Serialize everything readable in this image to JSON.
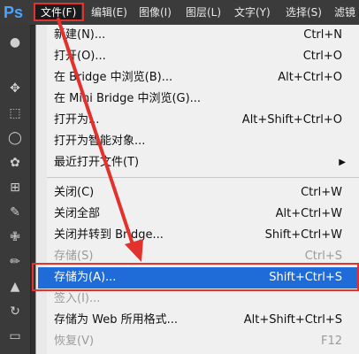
{
  "app": {
    "logo": "Ps"
  },
  "menubar": {
    "items": [
      {
        "label": "文件(F)",
        "active": true
      },
      {
        "label": "编辑(E)"
      },
      {
        "label": "图像(I)"
      },
      {
        "label": "图层(L)"
      },
      {
        "label": "文字(Y)"
      },
      {
        "label": "选择(S)"
      },
      {
        "label": "滤镜"
      }
    ]
  },
  "file_menu": {
    "items": [
      {
        "label": "新建(N)...",
        "shortcut": "Ctrl+N"
      },
      {
        "label": "打开(O)...",
        "shortcut": "Ctrl+O"
      },
      {
        "label": "在 Bridge 中浏览(B)...",
        "shortcut": "Alt+Ctrl+O"
      },
      {
        "label": "在 Mini Bridge 中浏览(G)...",
        "shortcut": ""
      },
      {
        "label": "打开为...",
        "shortcut": "Alt+Shift+Ctrl+O"
      },
      {
        "label": "打开为智能对象...",
        "shortcut": ""
      },
      {
        "label": "最近打开文件(T)",
        "shortcut": "",
        "submenu": true
      },
      {
        "label": "关闭(C)",
        "shortcut": "Ctrl+W"
      },
      {
        "label": "关闭全部",
        "shortcut": "Alt+Ctrl+W"
      },
      {
        "label": "关闭并转到 Bridge...",
        "shortcut": "Shift+Ctrl+W"
      },
      {
        "label": "存储(S)",
        "shortcut": "Ctrl+S",
        "disabled": true
      },
      {
        "label": "存储为(A)...",
        "shortcut": "Shift+Ctrl+S",
        "highlighted": true
      },
      {
        "label": "签入(I)...",
        "shortcut": "",
        "disabled": true
      },
      {
        "label": "存储为 Web 所用格式...",
        "shortcut": "Alt+Shift+Ctrl+S"
      },
      {
        "label": "恢复(V)",
        "shortcut": "F12",
        "disabled": true
      }
    ]
  },
  "icons": {
    "tools": [
      "move-icon",
      "marquee-icon",
      "lasso-icon",
      "quick-select-icon",
      "crop-icon",
      "eyedropper-icon",
      "healing-icon",
      "brush-icon",
      "stamp-icon",
      "history-brush-icon",
      "eraser-icon",
      "paint-bucket-icon"
    ]
  },
  "colors": {
    "accent": "#1f6bd8",
    "annotation": "#e3312d"
  }
}
